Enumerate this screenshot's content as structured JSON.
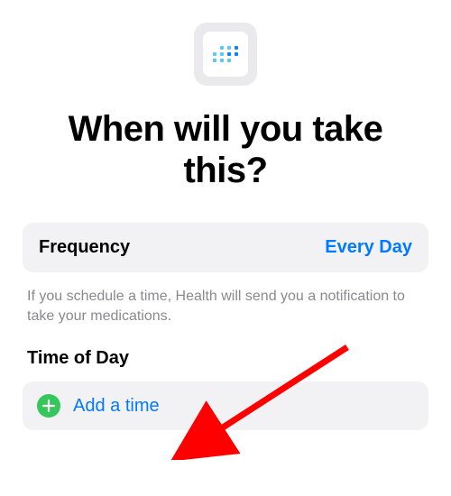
{
  "headline": "When will you take this?",
  "frequency": {
    "label": "Frequency",
    "value": "Every Day"
  },
  "hint": "If you schedule a time, Health will send you a notification to take your medications.",
  "timeOfDay": {
    "title": "Time of Day",
    "addLabel": "Add a time"
  },
  "colors": {
    "accent": "#007aff",
    "plus": "#34c759",
    "arrow": "#ff0000"
  }
}
